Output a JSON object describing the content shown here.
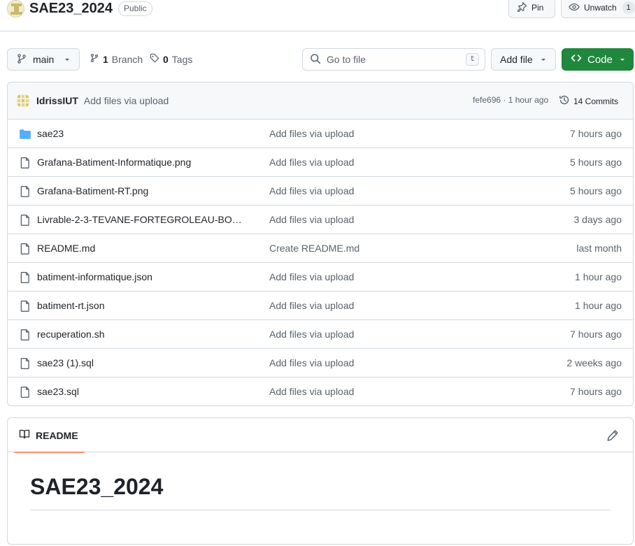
{
  "repo": {
    "name": "SAE23_2024",
    "visibility": "Public",
    "pin_label": "Pin",
    "watch_label": "Unwatch",
    "watch_count": "1"
  },
  "toolbar": {
    "branch": "main",
    "branch_count": "1",
    "branch_label": "Branch",
    "tag_count": "0",
    "tag_label": "Tags",
    "search_placeholder": "Go to file",
    "search_shortcut": "t",
    "add_file_label": "Add file",
    "code_label": "Code"
  },
  "latest_commit": {
    "author": "IdrissIUT",
    "message": "Add files via upload",
    "sha": "fefe696",
    "separator": "·",
    "time": "1 hour ago",
    "commits_label": "14 Commits"
  },
  "files": [
    {
      "name": "sae23",
      "type": "folder",
      "commit": "Add files via upload",
      "time": "7 hours ago"
    },
    {
      "name": "Grafana-Batiment-Informatique.png",
      "type": "file",
      "commit": "Add files via upload",
      "time": "5 hours ago"
    },
    {
      "name": "Grafana-Batiment-RT.png",
      "type": "file",
      "commit": "Add files via upload",
      "time": "5 hours ago"
    },
    {
      "name": "Livrable-2-3-TEVANE-FORTEGROLEAU-BO…",
      "type": "file",
      "commit": "Add files via upload",
      "time": "3 days ago"
    },
    {
      "name": "README.md",
      "type": "file",
      "commit": "Create README.md",
      "time": "last month"
    },
    {
      "name": "batiment-informatique.json",
      "type": "file",
      "commit": "Add files via upload",
      "time": "1 hour ago"
    },
    {
      "name": "batiment-rt.json",
      "type": "file",
      "commit": "Add files via upload",
      "time": "1 hour ago"
    },
    {
      "name": "recuperation.sh",
      "type": "file",
      "commit": "Add files via upload",
      "time": "7 hours ago"
    },
    {
      "name": "sae23 (1).sql",
      "type": "file",
      "commit": "Add files via upload",
      "time": "2 weeks ago"
    },
    {
      "name": "sae23.sql",
      "type": "file",
      "commit": "Add files via upload",
      "time": "7 hours ago"
    }
  ],
  "readme": {
    "tab_label": "README",
    "title": "SAE23_2024"
  },
  "colors": {
    "accent_green": "#1f883d",
    "folder_blue": "#54aeff",
    "tab_underline": "#fd8c73"
  }
}
